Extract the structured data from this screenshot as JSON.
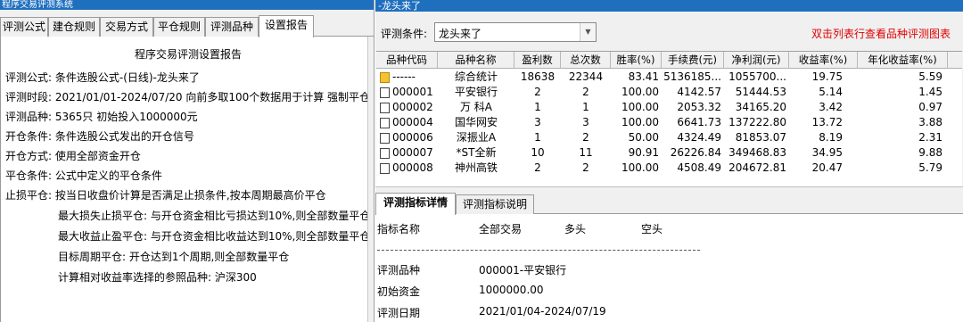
{
  "left_window": {
    "title": "程序交易评测系统",
    "tabs": [
      {
        "label": "评测公式",
        "active": false
      },
      {
        "label": "建仓规则",
        "active": false
      },
      {
        "label": "交易方式",
        "active": false
      },
      {
        "label": "平仓规则",
        "active": false
      },
      {
        "label": "评测品种",
        "active": false
      },
      {
        "label": "设置报告",
        "active": true
      }
    ],
    "report": {
      "title": "程序交易评测设置报告",
      "lines": [
        "评测公式: 条件选股公式-(日线)-龙头来了",
        "评测时段: 2021/01/01-2024/07/20 向前多取100个数据用于计算 强制平仓计",
        "评测品种: 5365只 初始投入1000000元",
        "开仓条件: 条件选股公式发出的开仓信号",
        "开仓方式: 使用全部资金开仓",
        "平仓条件: 公式中定义的平仓条件",
        "止损平仓: 按当日收盘价计算是否满足止损条件,按本周期最高价平仓"
      ],
      "indented_lines": [
        "最大损失止损平仓: 与开仓资金相比亏损达到10%,则全部数量平仓",
        "最大收益止盈平仓: 与开仓资金相比收益达到10%,则全部数量平仓",
        "目标周期平仓: 开仓达到1个周期,则全部数量平仓",
        "计算相对收益率选择的参照品种: 沪深300"
      ]
    }
  },
  "right_window": {
    "title": "-龙头来了",
    "condition_label": "评测条件:",
    "condition_value": "龙头来了",
    "hint": "双击列表行查看品种评测图表",
    "table": {
      "columns": [
        "品种代码",
        "品种名称",
        "盈利数",
        "总次数",
        "胜率(%)",
        "手续费(元)",
        "净利润(元)",
        "收益率(%)",
        "年化收益率(%)"
      ],
      "rows": [
        [
          "------",
          "综合统计",
          "18638",
          "22344",
          "83.41",
          "5136185...",
          "1055700...",
          "19.75",
          "5.59"
        ],
        [
          "000001",
          "平安银行",
          "2",
          "2",
          "100.00",
          "4142.57",
          "51444.53",
          "5.14",
          "1.45"
        ],
        [
          "000002",
          "万 科A",
          "1",
          "1",
          "100.00",
          "2053.32",
          "34165.20",
          "3.42",
          "0.97"
        ],
        [
          "000004",
          "国华网安",
          "3",
          "3",
          "100.00",
          "6641.73",
          "137222.80",
          "13.72",
          "3.88"
        ],
        [
          "000006",
          "深振业A",
          "1",
          "2",
          "50.00",
          "4324.49",
          "81853.07",
          "8.19",
          "2.31"
        ],
        [
          "000007",
          "*ST全新",
          "10",
          "11",
          "90.91",
          "26226.84",
          "349468.83",
          "34.95",
          "9.88"
        ],
        [
          "000008",
          "神州高铁",
          "2",
          "2",
          "100.00",
          "4508.49",
          "204672.81",
          "20.47",
          "5.79"
        ]
      ]
    },
    "bottom_tabs": [
      {
        "label": "评测指标详情",
        "active": true
      },
      {
        "label": "评测指标说明",
        "active": false
      }
    ],
    "detail": {
      "headers": [
        "指标名称",
        "全部交易",
        "多头",
        "空头"
      ],
      "items": [
        {
          "label": "评测品种",
          "value": "000001-平安银行"
        },
        {
          "label": "初始资金",
          "value": "1000000.00"
        },
        {
          "label": "评测日期",
          "value": "2021/01/04-2024/07/19"
        }
      ]
    }
  }
}
